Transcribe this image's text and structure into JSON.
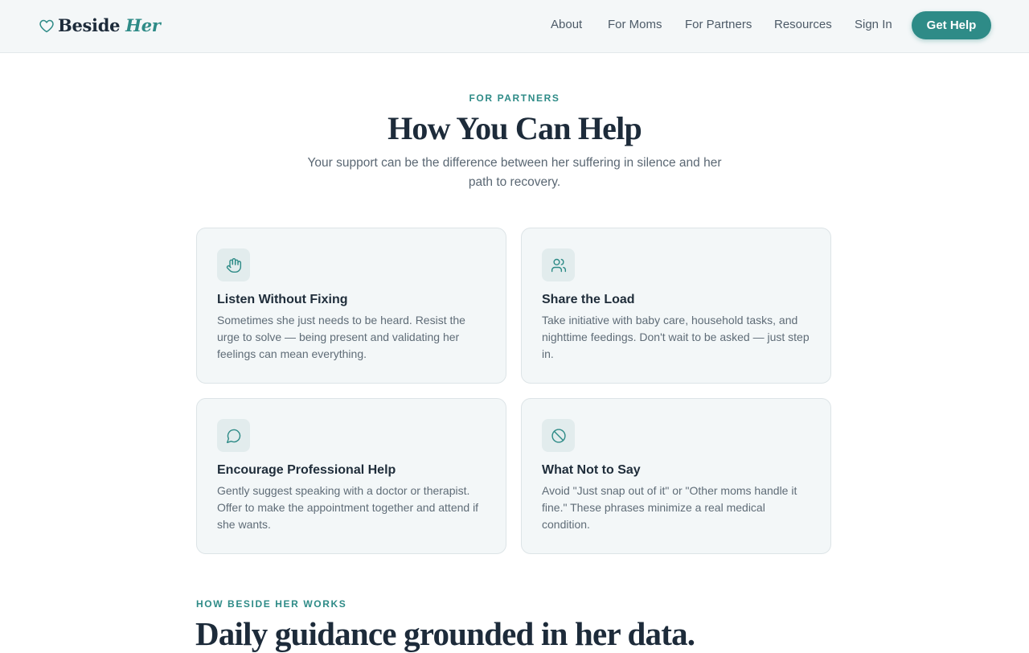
{
  "header": {
    "brand_word1": "Beside",
    "brand_word2": "Her",
    "nav": [
      "About",
      "For Moms",
      "For Partners",
      "Resources",
      "Sign In"
    ],
    "cta_label": "Get Help"
  },
  "intro": {
    "eyebrow": "FOR PARTNERS",
    "title": "How You Can Help",
    "description": "Your support can be the difference between her suffering in silence and her path to recovery."
  },
  "cards": [
    {
      "icon": "hand-icon",
      "title": "Listen Without Fixing",
      "description": "Sometimes she just needs to be heard. Resist the urge to solve — being present and validating her feelings can mean everything."
    },
    {
      "icon": "users-icon",
      "title": "Share the Load",
      "description": "Take initiative with baby care, household tasks, and nighttime feedings. Don't wait to be asked — just step in."
    },
    {
      "icon": "message-circle-icon",
      "title": "Encourage Professional Help",
      "description": "Gently suggest speaking with a doctor or therapist. Offer to make the appointment together and attend if she wants."
    },
    {
      "icon": "ban-icon",
      "title": "What Not to Say",
      "description": "Avoid \"Just snap out of it\" or \"Other moms handle it fine.\" These phrases minimize a real medical condition."
    }
  ],
  "how_it_works": {
    "eyebrow": "HOW BESIDE HER WORKS",
    "title": "Daily guidance grounded in her data."
  },
  "colors": {
    "accent": "#2e8b87",
    "heading": "#1d2b3a",
    "body_text": "#5f6c77",
    "card_bg": "#f3f7f8",
    "header_bg": "#f4f7f8"
  }
}
